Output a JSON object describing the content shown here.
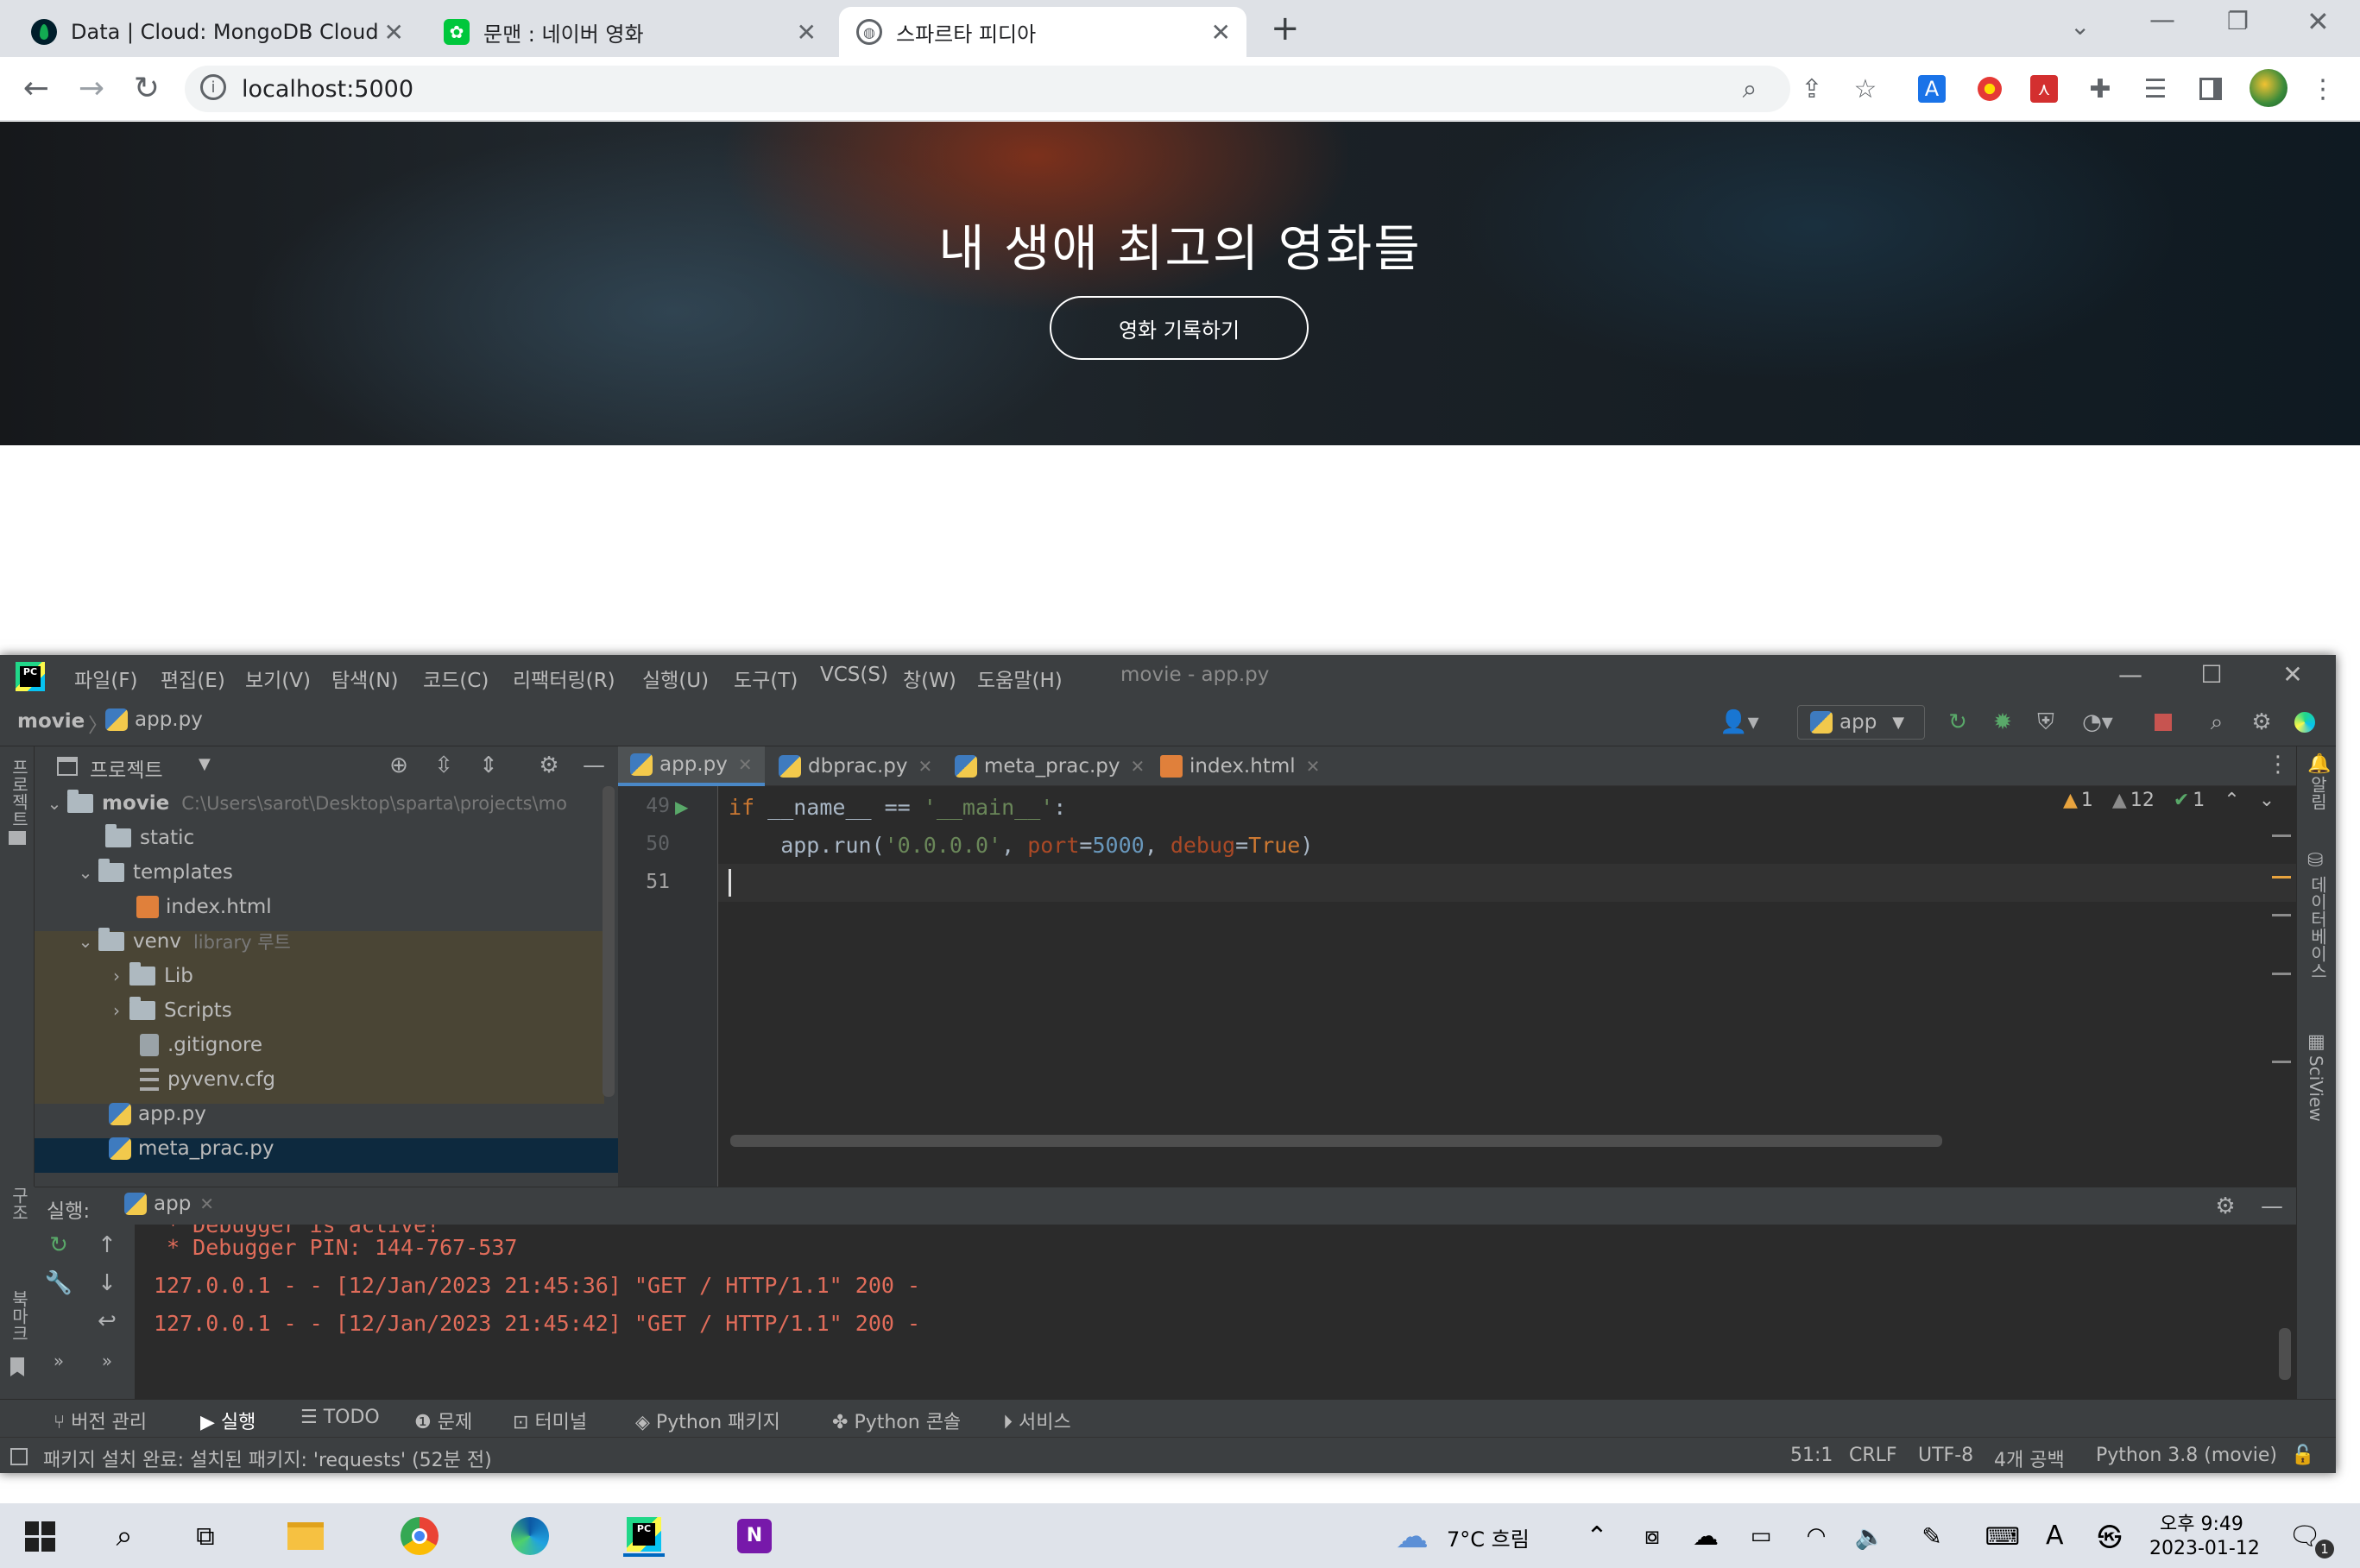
{
  "browser": {
    "tabs": [
      {
        "title": "Data | Cloud: MongoDB Cloud",
        "icon": "mongodb-leaf-icon",
        "color": "#13aa52"
      },
      {
        "title": "문맨 : 네이버 영화",
        "icon": "naver-movie-icon",
        "color": "#00c73c"
      },
      {
        "title": "스파르타 피디아",
        "icon": "globe-icon",
        "color": "#5f6368"
      }
    ],
    "new_tab_label": "+",
    "url": "localhost:5000",
    "extensions": [
      "translate-icon",
      "pomodoro-icon",
      "acrobat-icon",
      "extensions-puzzle-icon",
      "reading-list-icon",
      "side-panel-icon",
      "profile-avatar",
      "menu-kebab-icon"
    ]
  },
  "page": {
    "hero_title": "내 생애 최고의 영화들",
    "hero_button": "영화 기록하기"
  },
  "ide": {
    "menu": [
      "파일(F)",
      "편집(E)",
      "보기(V)",
      "탐색(N)",
      "코드(C)",
      "리팩터링(R)",
      "실행(U)",
      "도구(T)",
      "VCS(S)",
      "창(W)",
      "도움말(H)"
    ],
    "window_title": "movie - app.py",
    "breadcrumb": {
      "project": "movie",
      "file": "app.py"
    },
    "run_config": "app",
    "project_panel_title": "프로젝트",
    "left_strip_labels": [
      "프로젝트",
      "구조",
      "북마크"
    ],
    "right_strip_labels": [
      "알림",
      "데이터베이스",
      "SciView"
    ],
    "tree": [
      {
        "level": 0,
        "type": "folder",
        "name": "movie",
        "hint": "C:\\Users\\sarot\\Desktop\\sparta\\projects\\mo",
        "expanded": true
      },
      {
        "level": 1,
        "type": "folder",
        "name": "static"
      },
      {
        "level": 1,
        "type": "folder",
        "name": "templates",
        "expanded": true
      },
      {
        "level": 2,
        "type": "html",
        "name": "index.html"
      },
      {
        "level": 1,
        "type": "folder",
        "name": "venv",
        "hint": "library 루트",
        "expanded": true
      },
      {
        "level": 2,
        "type": "folder",
        "name": "Lib",
        "collapsed": true
      },
      {
        "level": 2,
        "type": "folder",
        "name": "Scripts",
        "collapsed": true
      },
      {
        "level": 2,
        "type": "git",
        "name": ".gitignore"
      },
      {
        "level": 2,
        "type": "cfg",
        "name": "pyvenv.cfg"
      },
      {
        "level": 1,
        "type": "py",
        "name": "app.py"
      },
      {
        "level": 1,
        "type": "py",
        "name": "meta_prac.py"
      }
    ],
    "editor_tabs": [
      "app.py",
      "dbprac.py",
      "meta_prac.py",
      "index.html"
    ],
    "inspections": {
      "warnings": "1",
      "weak_warnings": "12",
      "ok": "1"
    },
    "code_lines": [
      {
        "num": "49",
        "parts": [
          [
            "kw",
            "if "
          ],
          [
            "plain",
            "__name__ == "
          ],
          [
            "str",
            "'__main__'"
          ],
          [
            "plain",
            ":"
          ]
        ]
      },
      {
        "num": "50",
        "parts": [
          [
            "plain",
            "    app.run("
          ],
          [
            "str",
            "'0.0.0.0'"
          ],
          [
            "plain",
            ", "
          ],
          [
            "param",
            "port"
          ],
          [
            "plain",
            "="
          ],
          [
            "num",
            "5000"
          ],
          [
            "plain",
            ", "
          ],
          [
            "param",
            "debug"
          ],
          [
            "plain",
            "="
          ],
          [
            "kw",
            "True"
          ],
          [
            "plain",
            ")"
          ]
        ]
      },
      {
        "num": "51",
        "parts": []
      }
    ],
    "run_panel": {
      "label": "실행:",
      "tab": "app",
      "console": [
        " * Debugger PIN: 144-767-537",
        "127.0.0.1 - - [12/Jan/2023 21:45:36] \"GET / HTTP/1.1\" 200 -",
        "127.0.0.1 - - [12/Jan/2023 21:45:42] \"GET / HTTP/1.1\" 200 -"
      ]
    },
    "tool_windows": [
      "버전 관리",
      "실행",
      "TODO",
      "문제",
      "터미널",
      "Python 패키지",
      "Python 콘솔",
      "서비스"
    ],
    "status": {
      "message": "패키지 설치 완료: 설치된 패키지: 'requests' (52분 전)",
      "position": "51:1",
      "line_sep": "CRLF",
      "encoding": "UTF-8",
      "indent": "4개 공백",
      "interpreter": "Python 3.8 (movie)"
    }
  },
  "taskbar": {
    "weather": "7°C 흐림",
    "time": "오후 9:49",
    "date": "2023-01-12",
    "notifications": "1",
    "ime": "A"
  }
}
